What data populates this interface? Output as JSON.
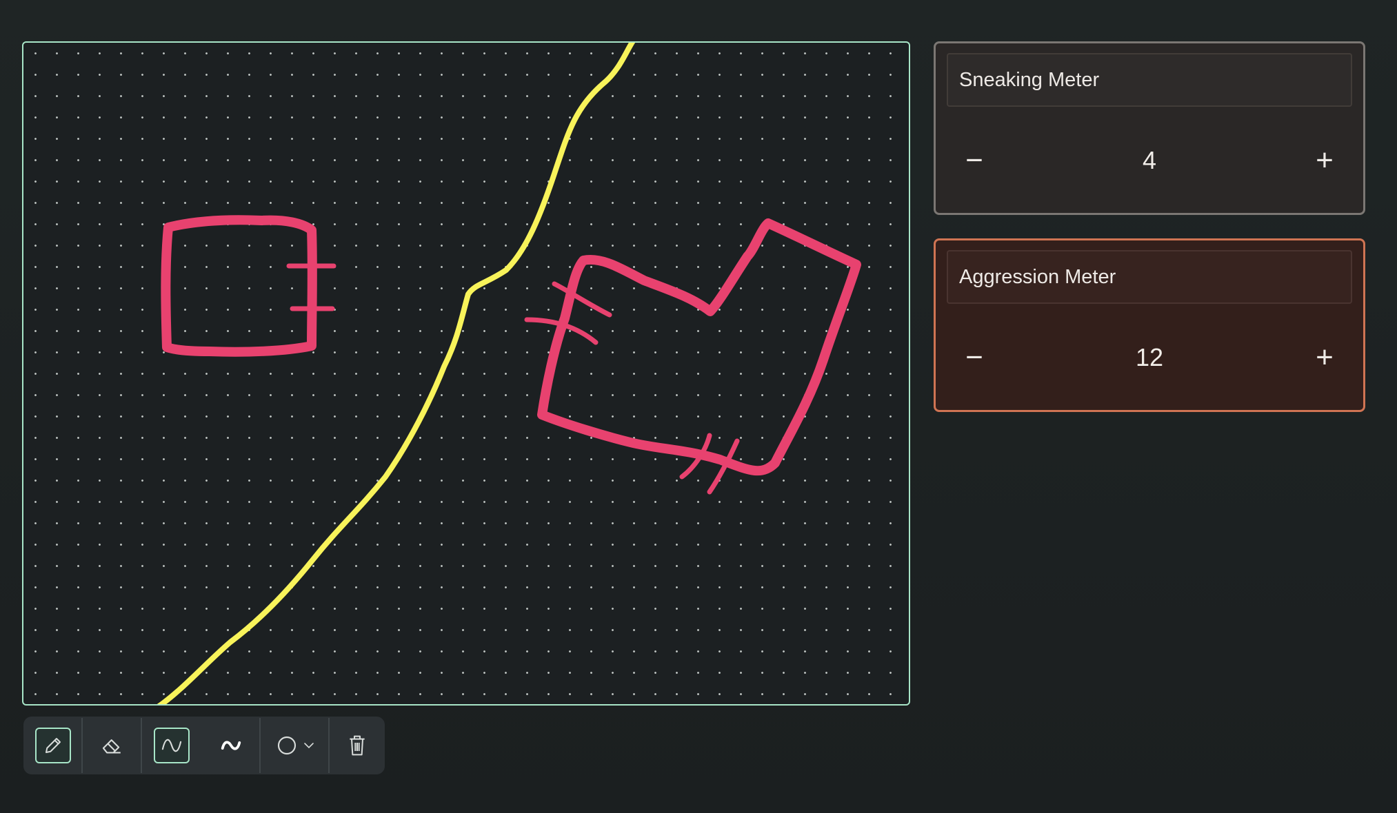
{
  "canvas": {
    "strokes": [
      {
        "color": "#f8f35a",
        "shape": "freehand-line"
      },
      {
        "color": "#e8426f",
        "shape": "small-square-with-ticks"
      },
      {
        "color": "#e8426f",
        "shape": "notched-polygon-with-ticks"
      }
    ]
  },
  "toolbar": {
    "tools": [
      {
        "name": "pencil-icon",
        "active": true
      },
      {
        "name": "eraser-icon",
        "active": false
      },
      {
        "name": "smooth-curve-icon",
        "active": true
      },
      {
        "name": "wave-icon",
        "active": false
      },
      {
        "name": "circle-shape-icon",
        "active": false
      },
      {
        "name": "trash-icon",
        "active": false
      }
    ]
  },
  "meters": [
    {
      "title": "Sneaking Meter",
      "value": "4",
      "minus": "−",
      "plus": "+"
    },
    {
      "title": "Aggression Meter",
      "value": "12",
      "minus": "−",
      "plus": "+"
    }
  ],
  "colors": {
    "accent": "#a8e6c8",
    "stroke_yellow": "#f8f35a",
    "stroke_pink": "#e8426f",
    "aggression_border": "#d07453"
  }
}
